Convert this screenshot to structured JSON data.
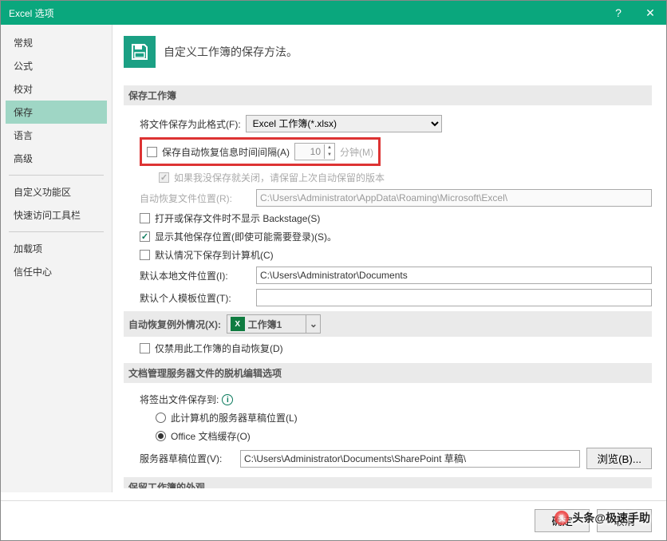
{
  "window": {
    "title": "Excel 选项",
    "help": "?",
    "close": "✕"
  },
  "sidebar": {
    "items": [
      "常规",
      "公式",
      "校对",
      "保存",
      "语言",
      "高级",
      "自定义功能区",
      "快速访问工具栏",
      "加载项",
      "信任中心"
    ],
    "selectedIndex": 3,
    "sepAfter": [
      5,
      7
    ]
  },
  "header": {
    "desc": "自定义工作簿的保存方法。"
  },
  "section_save": {
    "title": "保存工作簿",
    "format_label": "将文件保存为此格式(F):",
    "format_value": "Excel 工作簿(*.xlsx)",
    "autosave_label": "保存自动恢复信息时间间隔(A)",
    "autosave_value": "10",
    "autosave_unit": "分钟(M)",
    "keep_last_label": "如果我没保存就关闭，请保留上次自动保留的版本",
    "recover_loc_label": "自动恢复文件位置(R):",
    "recover_loc_value": "C:\\Users\\Administrator\\AppData\\Roaming\\Microsoft\\Excel\\",
    "no_backstage_label": "打开或保存文件时不显示 Backstage(S)",
    "show_other_label": "显示其他保存位置(即使可能需要登录)(S)。",
    "default_pc_label": "默认情况下保存到计算机(C)",
    "default_local_label": "默认本地文件位置(I):",
    "default_local_value": "C:\\Users\\Administrator\\Documents",
    "default_tmpl_label": "默认个人模板位置(T):",
    "default_tmpl_value": ""
  },
  "section_except": {
    "title": "自动恢复例外情况(X):",
    "workbook": "工作簿1",
    "disable_label": "仅禁用此工作簿的自动恢复(D)"
  },
  "section_server": {
    "title": "文档管理服务器文件的脱机编辑选项",
    "saveto_label": "将签出文件保存到:",
    "radio_draft": "此计算机的服务器草稿位置(L)",
    "radio_cache": "Office 文档缓存(O)",
    "draft_loc_label": "服务器草稿位置(V):",
    "draft_loc_value": "C:\\Users\\Administrator\\Documents\\SharePoint 草稿\\",
    "browse": "浏览(B)..."
  },
  "section_cut": {
    "title": "保留工作簿的外观"
  },
  "footer": {
    "ok": "确定",
    "cancel": "取消"
  },
  "watermark": "头条@极速手助"
}
